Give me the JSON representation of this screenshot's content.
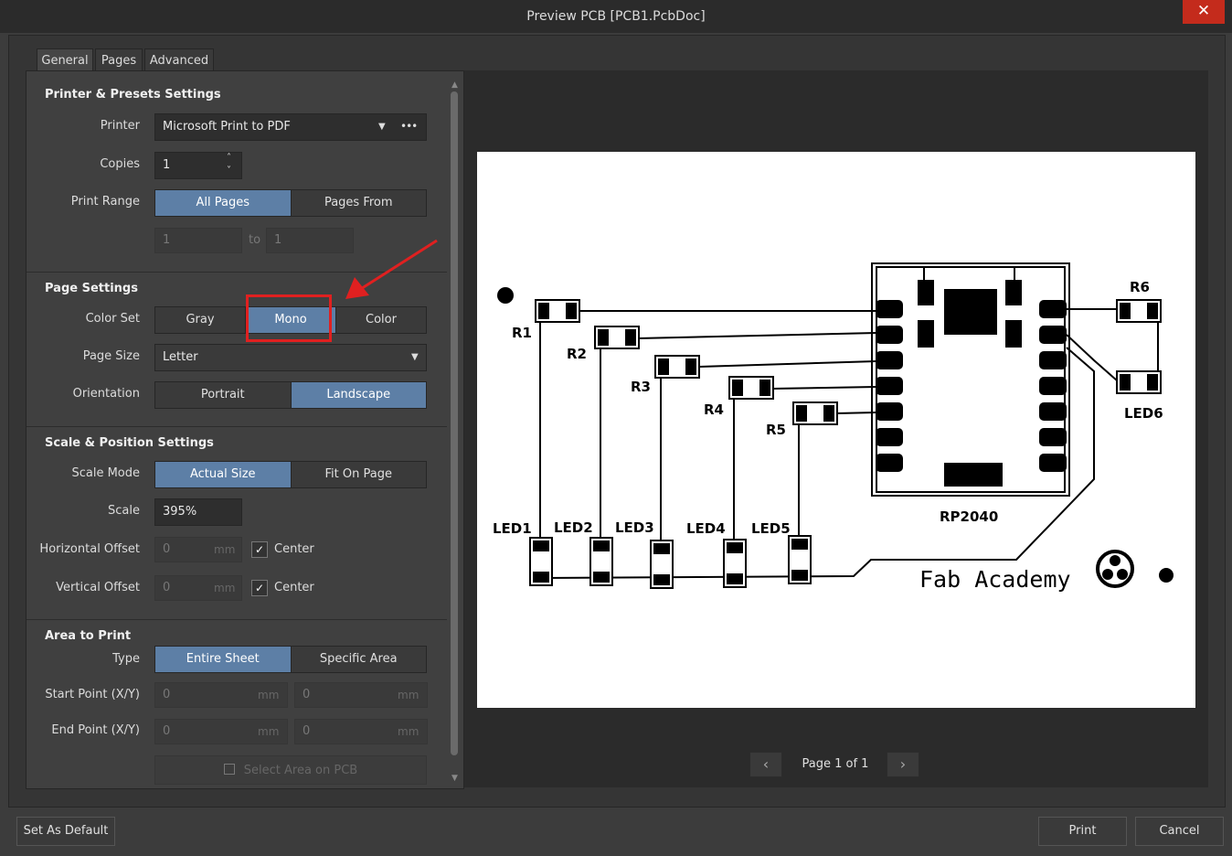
{
  "window": {
    "title": "Preview PCB [PCB1.PcbDoc]",
    "close_glyph": "✕"
  },
  "tabs": [
    {
      "label": "General"
    },
    {
      "label": "Pages"
    },
    {
      "label": "Advanced"
    }
  ],
  "printer_section": {
    "title": "Printer & Presets Settings",
    "printer_label": "Printer",
    "printer_value": "Microsoft Print to PDF",
    "more_glyph": "•••",
    "copies_label": "Copies",
    "copies_value": "1",
    "print_range_label": "Print Range",
    "print_range_options": [
      "All Pages",
      "Pages From"
    ],
    "print_range_selected": "All Pages",
    "range_from": "1",
    "range_to_label": "to",
    "range_to": "1"
  },
  "page_section": {
    "title": "Page Settings",
    "color_set_label": "Color Set",
    "color_set_options": [
      "Gray",
      "Mono",
      "Color"
    ],
    "color_set_selected": "Mono",
    "page_size_label": "Page Size",
    "page_size_value": "Letter",
    "orientation_label": "Orientation",
    "orientation_options": [
      "Portrait",
      "Landscape"
    ],
    "orientation_selected": "Landscape"
  },
  "scale_section": {
    "title": "Scale & Position Settings",
    "scale_mode_label": "Scale Mode",
    "scale_mode_options": [
      "Actual Size",
      "Fit On Page"
    ],
    "scale_mode_selected": "Actual Size",
    "scale_label": "Scale",
    "scale_value": "395%",
    "h_offset_label": "Horizontal Offset",
    "h_offset_value": "0",
    "v_offset_label": "Vertical Offset",
    "v_offset_value": "0",
    "unit": "mm",
    "center_label": "Center"
  },
  "area_section": {
    "title": "Area to Print",
    "type_label": "Type",
    "type_options": [
      "Entire Sheet",
      "Specific Area"
    ],
    "type_selected": "Entire Sheet",
    "start_label": "Start Point (X/Y)",
    "start_x": "0",
    "start_y": "0",
    "end_label": "End Point (X/Y)",
    "end_x": "0",
    "end_y": "0",
    "unit": "mm",
    "select_area_label": "Select Area on PCB"
  },
  "preview": {
    "page_indicator": "Page 1 of 1",
    "prev_glyph": "‹",
    "next_glyph": "›",
    "labels": {
      "r1": "R1",
      "r2": "R2",
      "r3": "R3",
      "r4": "R4",
      "r5": "R5",
      "r6": "R6",
      "led1": "LED1",
      "led2": "LED2",
      "led3": "LED3",
      "led4": "LED4",
      "led5": "LED5",
      "led6": "LED6",
      "mcu": "RP2040",
      "logo": "Fab Academy"
    }
  },
  "footer": {
    "set_default": "Set As Default",
    "print": "Print",
    "cancel": "Cancel"
  },
  "colors": {
    "accent": "#5d7fa6",
    "highlight": "#e02020",
    "close": "#c42b1c"
  }
}
